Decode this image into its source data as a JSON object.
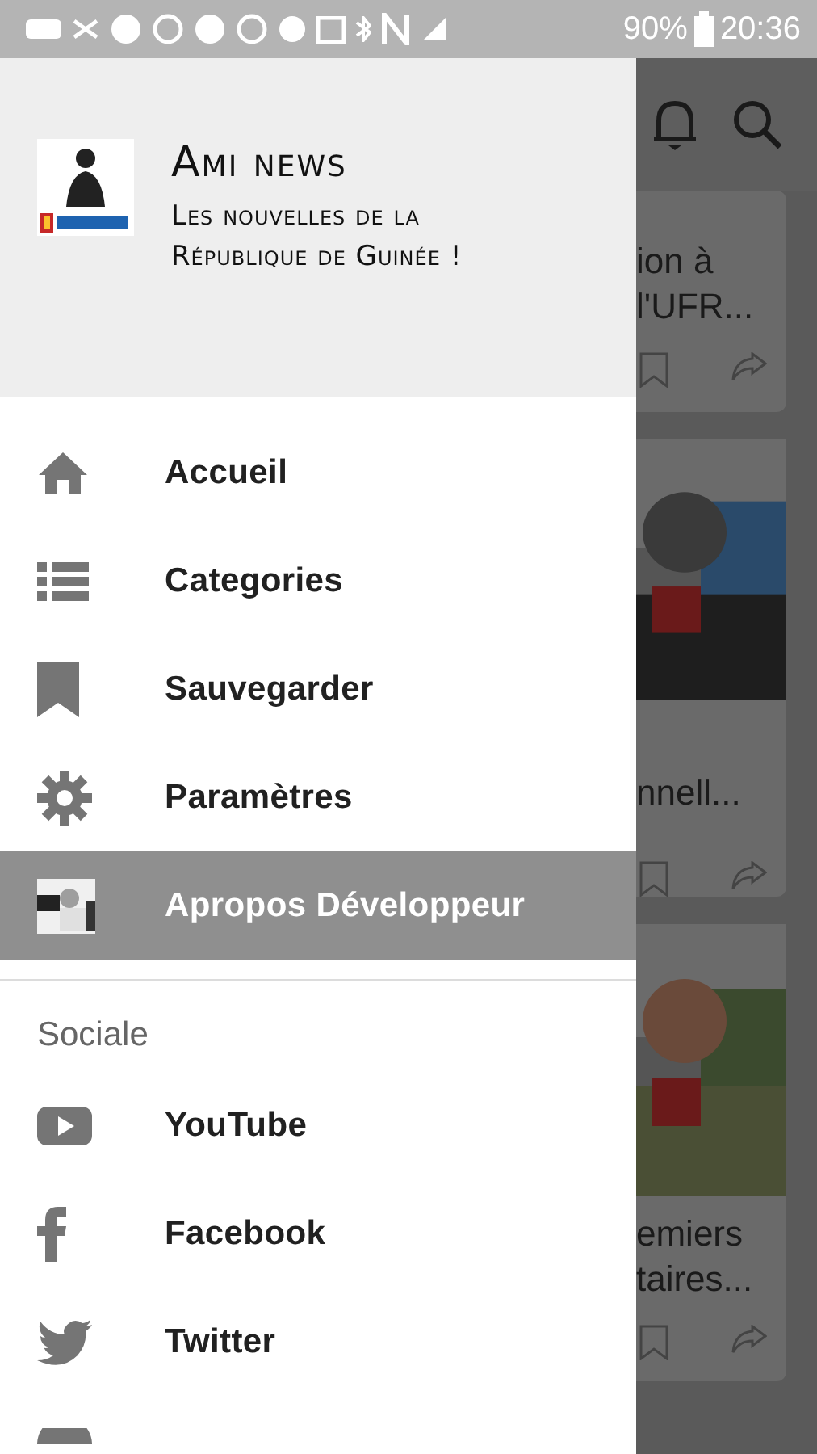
{
  "status_bar": {
    "battery": "90%",
    "time": "20:36"
  },
  "drawer": {
    "header": {
      "title": "Ami news",
      "subtitle": "Les nouvelles de la République de Guinée !"
    },
    "items": [
      {
        "label": "Accueil",
        "kind": "home",
        "selected": false
      },
      {
        "label": "Categories",
        "kind": "list",
        "selected": false
      },
      {
        "label": "Sauvegarder",
        "kind": "bookmark",
        "selected": false
      },
      {
        "label": "Paramètres",
        "kind": "gear",
        "selected": false
      },
      {
        "label": "Apropos Développeur",
        "selected": true
      }
    ],
    "section_title": "Sociale",
    "social": [
      {
        "label": "YouTube",
        "kind": "youtube"
      },
      {
        "label": "Facebook",
        "kind": "facebook"
      },
      {
        "label": "Twitter",
        "kind": "twitter"
      }
    ]
  },
  "background_feed": {
    "cards": [
      {
        "lines": [
          "ion à",
          "l'UFR..."
        ],
        "kind": "text"
      },
      {
        "lines": [
          "nnell..."
        ],
        "kind": "picture"
      },
      {
        "lines": [
          "emiers",
          "taires..."
        ],
        "kind": "picture"
      }
    ]
  }
}
